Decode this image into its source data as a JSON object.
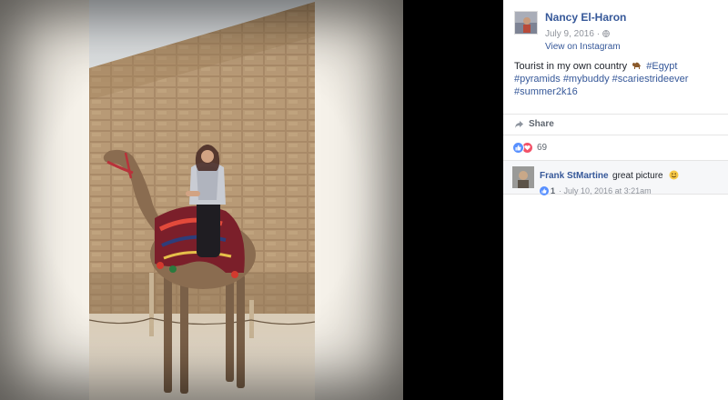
{
  "post": {
    "author_name": "Nancy El-Haron",
    "date": "July 9, 2016 · ",
    "view_link": "View on Instagram",
    "caption_text": "Tourist in my own country",
    "hashtags": [
      "#Egypt",
      "#pyramids",
      "#mybuddy",
      "#scariestrideever",
      "#summer2k16"
    ],
    "share_label": "Share",
    "reaction_count": "69"
  },
  "comment": {
    "author": "Frank StMartine",
    "text": "great picture",
    "likes": "1",
    "separator": "·",
    "timestamp": "July 10, 2016 at 3:21am"
  },
  "icons": {
    "globe": "globe-icon",
    "camel": "camel-emoji-icon",
    "share": "share-arrow-icon",
    "like": "like-reaction-icon",
    "love": "love-reaction-icon",
    "smile": "smile-emoji-icon"
  },
  "colors": {
    "link": "#365899",
    "like": "#5890ff",
    "love": "#f25268",
    "viewer_bg": "#000000"
  }
}
